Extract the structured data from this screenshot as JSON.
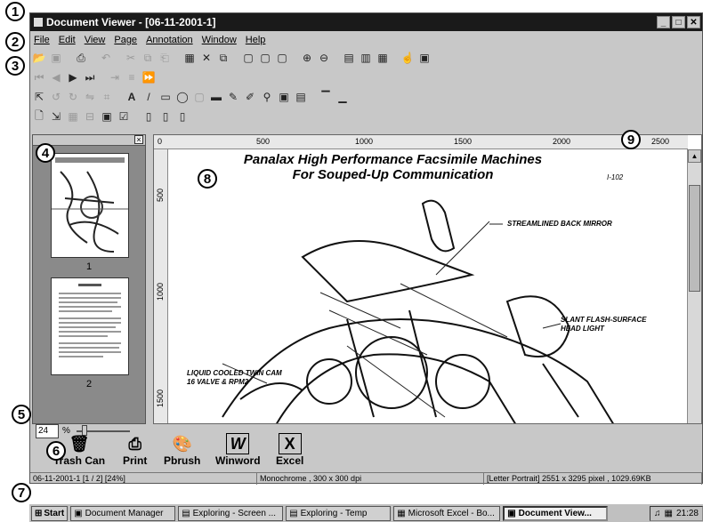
{
  "callouts": [
    "1",
    "2",
    "3",
    "4",
    "5",
    "6",
    "7",
    "8",
    "9"
  ],
  "window": {
    "title": "Document Viewer - [06-11-2001-1]",
    "min": "_",
    "max": "□",
    "close": "✕"
  },
  "menu": [
    "File",
    "Edit",
    "View",
    "Page",
    "Annotation",
    "Window",
    "Help"
  ],
  "zoom": {
    "value": "24",
    "unit": "%"
  },
  "thumbnails": {
    "page1_num": "1",
    "page2_num": "2"
  },
  "ruler": {
    "h_ticks": [
      "0",
      "500",
      "1000",
      "1500",
      "2000",
      "2500"
    ],
    "v_ticks": [
      "500",
      "1000",
      "1500"
    ]
  },
  "document": {
    "title_line1": "Panalax High Performance Facsimile Machines",
    "title_line2": "For Souped-Up Communication",
    "ref": "I-102",
    "label_mirror": "STREAMLINED BACK MIRROR",
    "label_flash_1": "SLANT FLASH-SURFACE",
    "label_flash_2": "HEAD LIGHT",
    "label_cam_1": "LIQUID COOLED TWIN CAM",
    "label_cam_2": "16 VALVE & RPM2"
  },
  "shortcuts": [
    {
      "label": "Trash Can",
      "icon": "trash-can-icon"
    },
    {
      "label": "Print",
      "icon": "printer-icon"
    },
    {
      "label": "Pbrush",
      "icon": "paintbrush-icon"
    },
    {
      "label": "Winword",
      "icon": "word-icon",
      "glyph": "W"
    },
    {
      "label": "Excel",
      "icon": "excel-icon",
      "glyph": "X"
    }
  ],
  "status": {
    "pages": "06-11-2001-1 [1 / 2] [24%]",
    "color": "Monochrome , 300 x 300 dpi",
    "size": "[Letter Portrait] 2551 x 3295 pixel , 1029.69KB"
  },
  "taskbar": {
    "start": "Start",
    "tasks": [
      "Document Manager",
      "Exploring - Screen ...",
      "Exploring - Temp",
      "Microsoft Excel - Bo...",
      "Document View..."
    ],
    "clock": "21:28"
  }
}
